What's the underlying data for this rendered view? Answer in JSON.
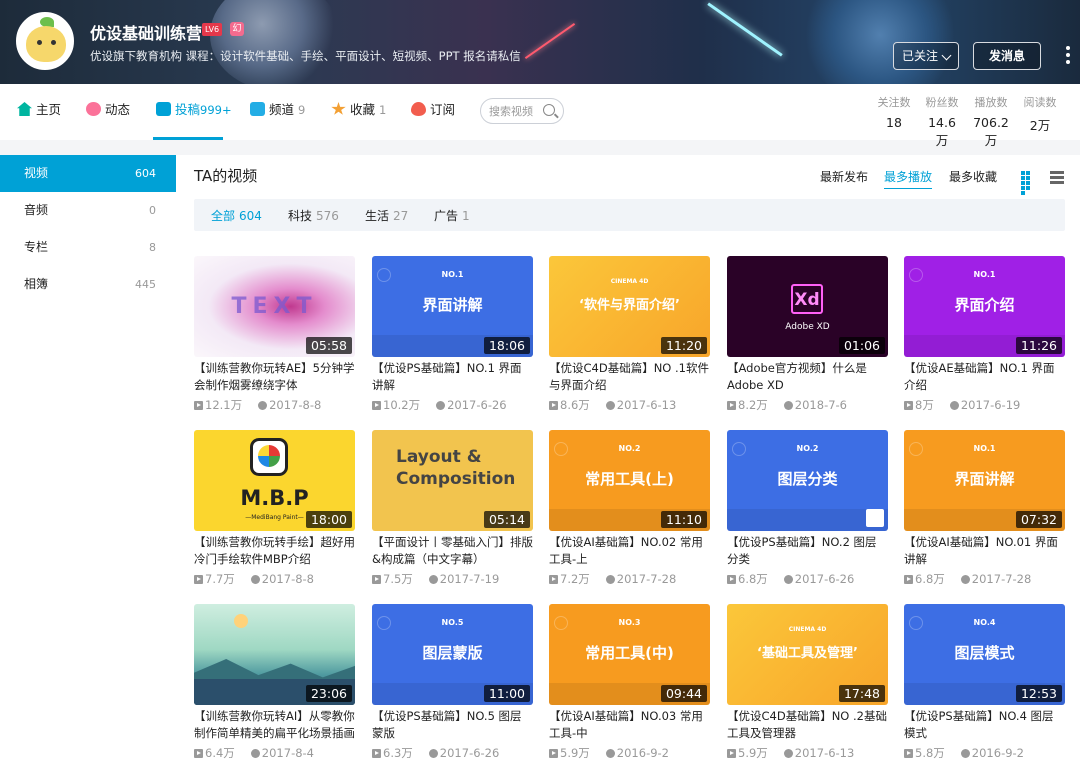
{
  "header": {
    "username": "优设基础训练营",
    "level_badge": "LV6",
    "role_badge": "幻",
    "sign": "优设旗下教育机构 课程：设计软件基础、手绘、平面设计、短视频、PPT 报名请私信",
    "follow_label": "已关注",
    "message_label": "发消息"
  },
  "nav": {
    "items": [
      {
        "label": "主页",
        "count": ""
      },
      {
        "label": "动态",
        "count": ""
      },
      {
        "label": "投稿",
        "count": "999+"
      },
      {
        "label": "频道",
        "count": "9"
      },
      {
        "label": "收藏",
        "count": "1"
      },
      {
        "label": "订阅",
        "count": ""
      }
    ],
    "search_placeholder": "搜索视频",
    "stats": [
      {
        "label": "关注数",
        "value": "18"
      },
      {
        "label": "粉丝数",
        "value": "14.6万"
      },
      {
        "label": "播放数",
        "value": "706.2万"
      },
      {
        "label": "阅读数",
        "value": "2万"
      }
    ],
    "colors": {
      "accent": "#00a1d6"
    }
  },
  "sidebar": {
    "items": [
      {
        "label": "视频",
        "count": "604"
      },
      {
        "label": "音频",
        "count": "0"
      },
      {
        "label": "专栏",
        "count": "8"
      },
      {
        "label": "相簿",
        "count": "445"
      }
    ]
  },
  "main": {
    "title": "TA的视频",
    "sort": [
      "最新发布",
      "最多播放",
      "最多收藏"
    ],
    "filters": [
      {
        "label": "全部",
        "count": "604"
      },
      {
        "label": "科技",
        "count": "576"
      },
      {
        "label": "生活",
        "count": "27"
      },
      {
        "label": "广告",
        "count": "1"
      }
    ],
    "videos": [
      {
        "title": "【训练营教你玩转AE】5分钟学会制作烟雾缭绕字体",
        "duration": "05:58",
        "plays": "12.1万",
        "date": "2017-8-8",
        "thumb_text": "TEXT",
        "thumb_tag": ""
      },
      {
        "title": "【优设PS基础篇】NO.1 界面讲解",
        "duration": "18:06",
        "plays": "10.2万",
        "date": "2017-6-26",
        "thumb_text": "界面讲解",
        "thumb_tag": "NO.1"
      },
      {
        "title": "【优设C4D基础篇】NO .1软件与界面介绍",
        "duration": "11:20",
        "plays": "8.6万",
        "date": "2017-6-13",
        "thumb_text": "‘软件与界面介绍’",
        "thumb_tag": "CINEMA 4D"
      },
      {
        "title": "【Adobe官方视频】什么是Adobe XD",
        "duration": "01:06",
        "plays": "8.2万",
        "date": "2018-7-6",
        "thumb_text": "Adobe XD",
        "thumb_tag": "Xd"
      },
      {
        "title": "【优设AE基础篇】NO.1 界面介绍",
        "duration": "11:26",
        "plays": "8万",
        "date": "2017-6-19",
        "thumb_text": "界面介绍",
        "thumb_tag": "NO.1"
      },
      {
        "title": "【训练营教你玩转手绘】超好用冷门手绘软件MBP介绍",
        "duration": "18:00",
        "plays": "7.7万",
        "date": "2017-8-8",
        "thumb_text": "M.B.P",
        "thumb_tag": "—MediBang Paint—"
      },
      {
        "title": "【平面设计丨零基础入门】排版&构成篇（中文字幕）",
        "duration": "05:14",
        "plays": "7.5万",
        "date": "2017-7-19",
        "thumb_text": "Layout & Composition",
        "thumb_tag": ""
      },
      {
        "title": "【优设AI基础篇】NO.02 常用工具-上",
        "duration": "11:10",
        "plays": "7.2万",
        "date": "2017-7-28",
        "thumb_text": "常用工具(上)",
        "thumb_tag": "NO.2"
      },
      {
        "title": "【优设PS基础篇】NO.2 图层分类",
        "duration": "",
        "plays": "6.8万",
        "date": "2017-6-26",
        "thumb_text": "图层分类",
        "thumb_tag": "NO.2"
      },
      {
        "title": "【优设AI基础篇】NO.01 界面讲解",
        "duration": "07:32",
        "plays": "6.8万",
        "date": "2017-7-28",
        "thumb_text": "界面讲解",
        "thumb_tag": "NO.1"
      },
      {
        "title": "【训练营教你玩转AI】从零教你制作简单精美的扁平化场景插画",
        "duration": "23:06",
        "plays": "6.4万",
        "date": "2017-8-4",
        "thumb_text": "",
        "thumb_tag": ""
      },
      {
        "title": "【优设PS基础篇】NO.5 图层蒙版",
        "duration": "11:00",
        "plays": "6.3万",
        "date": "2017-6-26",
        "thumb_text": "图层蒙版",
        "thumb_tag": "NO.5"
      },
      {
        "title": "【优设AI基础篇】NO.03 常用工具-中",
        "duration": "09:44",
        "plays": "5.9万",
        "date": "2016-9-2",
        "thumb_text": "常用工具(中)",
        "thumb_tag": "NO.3"
      },
      {
        "title": "【优设C4D基础篇】NO .2基础工具及管理器",
        "duration": "17:48",
        "plays": "5.9万",
        "date": "2017-6-13",
        "thumb_text": "‘基础工具及管理’",
        "thumb_tag": "CINEMA 4D"
      },
      {
        "title": "【优设PS基础篇】NO.4 图层模式",
        "duration": "12:53",
        "plays": "5.8万",
        "date": "2016-9-2",
        "thumb_text": "图层模式",
        "thumb_tag": "NO.4"
      }
    ]
  }
}
